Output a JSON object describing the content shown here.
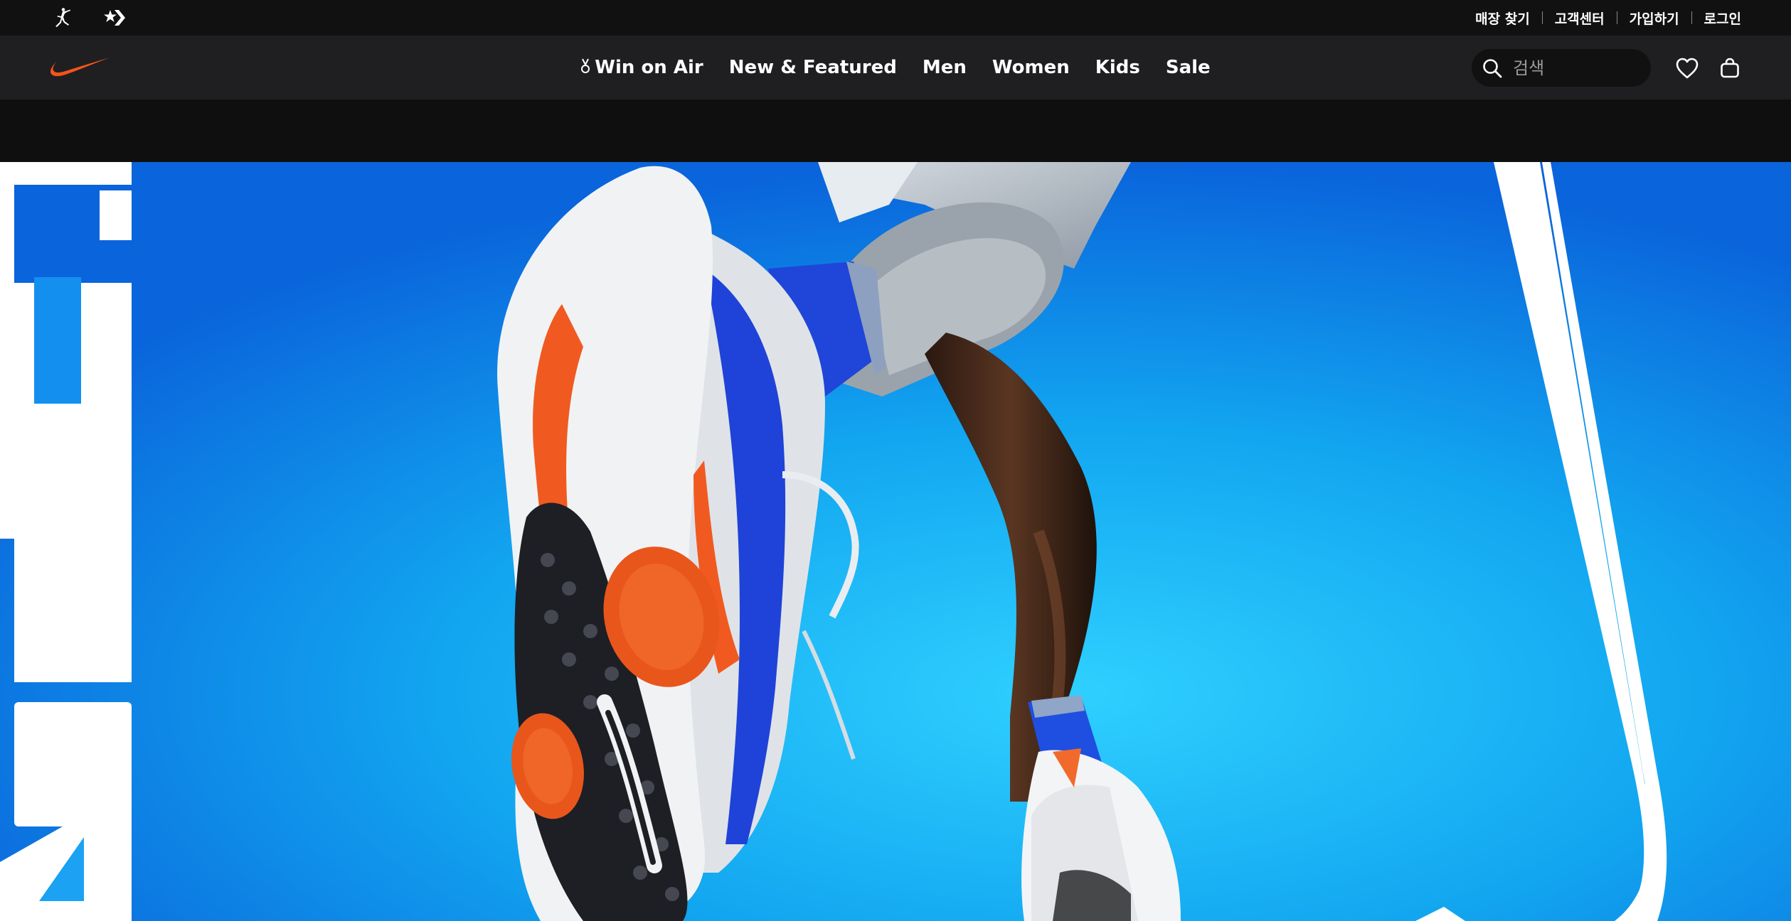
{
  "utility_bar": {
    "brands": [
      {
        "name": "jordan",
        "icon": "jordan-jumpman-icon"
      },
      {
        "name": "converse",
        "icon": "converse-star-chevron-icon"
      }
    ],
    "links": [
      "매장 찾기",
      "고객센터",
      "가입하기",
      "로그인"
    ]
  },
  "nav": {
    "logo_icon": "nike-swoosh-icon",
    "items": [
      {
        "label": "Win on Air",
        "icon": "medal-icon"
      },
      {
        "label": "New & Featured"
      },
      {
        "label": "Men"
      },
      {
        "label": "Women"
      },
      {
        "label": "Kids"
      },
      {
        "label": "Sale"
      }
    ],
    "search": {
      "placeholder": "검색",
      "icon": "search-icon"
    },
    "actions": [
      {
        "name": "favorites",
        "icon": "heart-icon"
      },
      {
        "name": "bag",
        "icon": "bag-icon"
      }
    ]
  },
  "colors": {
    "swoosh": "#f2541b",
    "nav_bg": "#1f1f21",
    "top_bg": "#111111",
    "hero_blue": "#15a9f0"
  }
}
